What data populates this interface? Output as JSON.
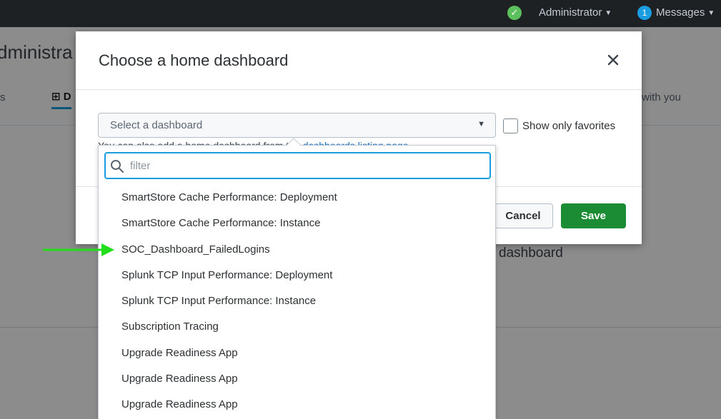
{
  "topbar": {
    "admin_label": "Administrator",
    "messages_count": "1",
    "messages_label": "Messages"
  },
  "background": {
    "page_title": "dministra",
    "tab_left": "s",
    "tab_active": "D",
    "tab_right": "with you",
    "heading_fragment": "dashboard"
  },
  "modal": {
    "title": "Choose a home dashboard",
    "select_placeholder": "Select a dashboard",
    "show_favorites_label": "Show only favorites",
    "show_favorites_checked": false,
    "helper_prefix": "You can also add a home dashboard from the ",
    "helper_link": "dashboards listing page",
    "cancel_label": "Cancel",
    "save_label": "Save",
    "save_color": "#1c8c34"
  },
  "dropdown": {
    "filter_placeholder": "filter",
    "options": [
      "SmartStore Cache Performance: Deployment",
      "SmartStore Cache Performance: Instance",
      "SOC_Dashboard_FailedLogins",
      "Splunk TCP Input Performance: Deployment",
      "Splunk TCP Input Performance: Instance",
      "Subscription Tracing",
      "Upgrade Readiness App",
      "Upgrade Readiness App",
      "Upgrade Readiness App"
    ]
  },
  "annotation": {
    "arrow_color": "#22dd1a",
    "points_to": "SOC_Dashboard_FailedLogins"
  }
}
